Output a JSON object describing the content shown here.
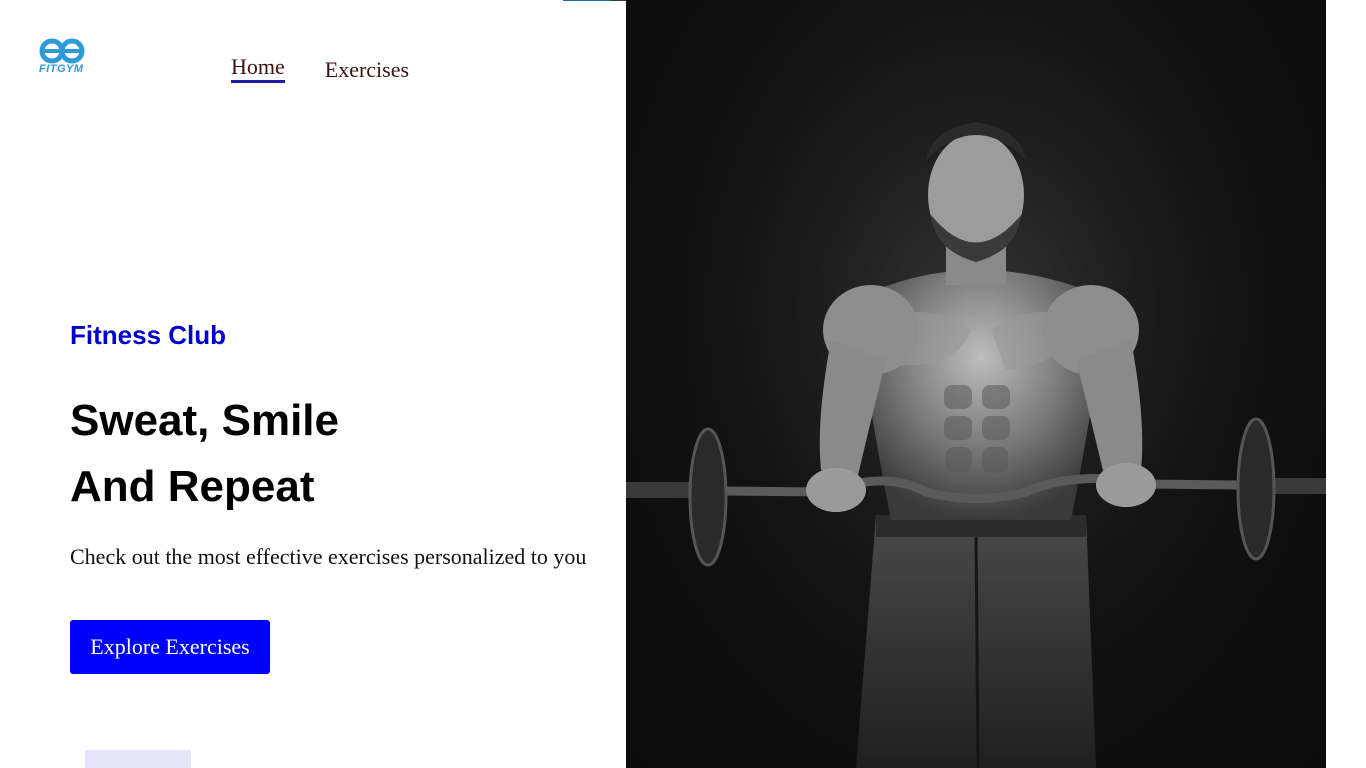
{
  "header": {
    "logo_text": "FITGYM",
    "nav": [
      {
        "label": "Home",
        "active": true
      },
      {
        "label": "Exercises",
        "active": false
      }
    ]
  },
  "hero": {
    "eyebrow": "Fitness Club",
    "headline_line1": "Sweat, Smile",
    "headline_line2": "And Repeat",
    "subtext": "Check out the most effective exercises personalized to you",
    "cta_label": "Explore Exercises",
    "image_alt": "Man lifting barbell"
  },
  "colors": {
    "accent": "#0000ff",
    "eyebrow": "#0000cc",
    "nav_underline": "#1c1c9c",
    "logo": "#2e9bd8"
  },
  "icons": {
    "logo": "fitgym-logo-icon"
  }
}
